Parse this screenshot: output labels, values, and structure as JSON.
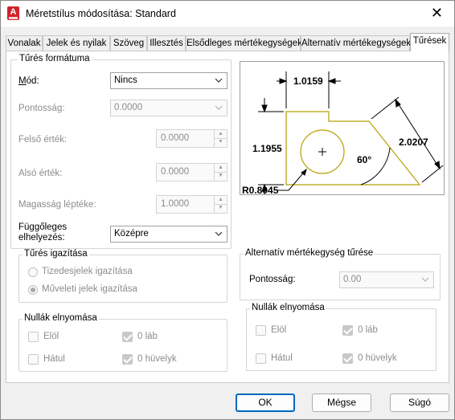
{
  "window": {
    "title": "Méretstílus módosítása: Standard",
    "app_icon_letter": "A"
  },
  "tabs": [
    {
      "label": "Vonalak"
    },
    {
      "label": "Jelek és nyilak"
    },
    {
      "label": "Szöveg"
    },
    {
      "label": "Illesztés"
    },
    {
      "label": "Elsődleges mértékegységek"
    },
    {
      "label": "Alternatív mértékegységek"
    },
    {
      "label": "Tűrések",
      "active": true
    }
  ],
  "tolerance_format": {
    "title": "Tűrés formátuma",
    "method": {
      "label": "Mód:",
      "value": "Nincs"
    },
    "precision": {
      "label": "Pontosság:",
      "value": "0.0000"
    },
    "upper_value": {
      "label": "Felső érték:",
      "value": "0.0000"
    },
    "lower_value": {
      "label": "Alsó érték:",
      "value": "0.0000"
    },
    "scaling": {
      "label": "Magasság léptéke:",
      "value": "1.0000"
    },
    "vertical_position": {
      "label_line1": "Függőleges",
      "label_line2": "elhelyezés:",
      "value": "Középre"
    }
  },
  "tolerance_alignment": {
    "title": "Tűrés igazítása",
    "align_decimal": "Tizedesjelek igazítása",
    "align_operational": "Műveleti jelek igazítása"
  },
  "zero_suppression_left": {
    "title": "Nullák elnyomása",
    "leading": "Elöl",
    "trailing": "Hátul",
    "zero_feet": "0 láb",
    "zero_inches": "0 hüvelyk"
  },
  "preview": {
    "dim_top": "1.0159",
    "dim_left": "1.1955",
    "dim_right": "2.0207",
    "angle": "60°",
    "radius": "R0.8045"
  },
  "alternate_tolerance": {
    "title": "Alternatív mértékegység tűrése",
    "precision": {
      "label": "Pontosság:",
      "value": "0.00"
    }
  },
  "zero_suppression_right": {
    "title": "Nullák elnyomása",
    "leading": "Elöl",
    "trailing": "Hátul",
    "zero_feet": "0 láb",
    "zero_inches": "0 hüvelyk"
  },
  "buttons": {
    "ok": "OK",
    "cancel": "Mégse",
    "help": "Súgó"
  },
  "colors": {
    "accent": "#0067c0",
    "app_icon": "#d2232a",
    "preview_outline": "#b5a000"
  }
}
